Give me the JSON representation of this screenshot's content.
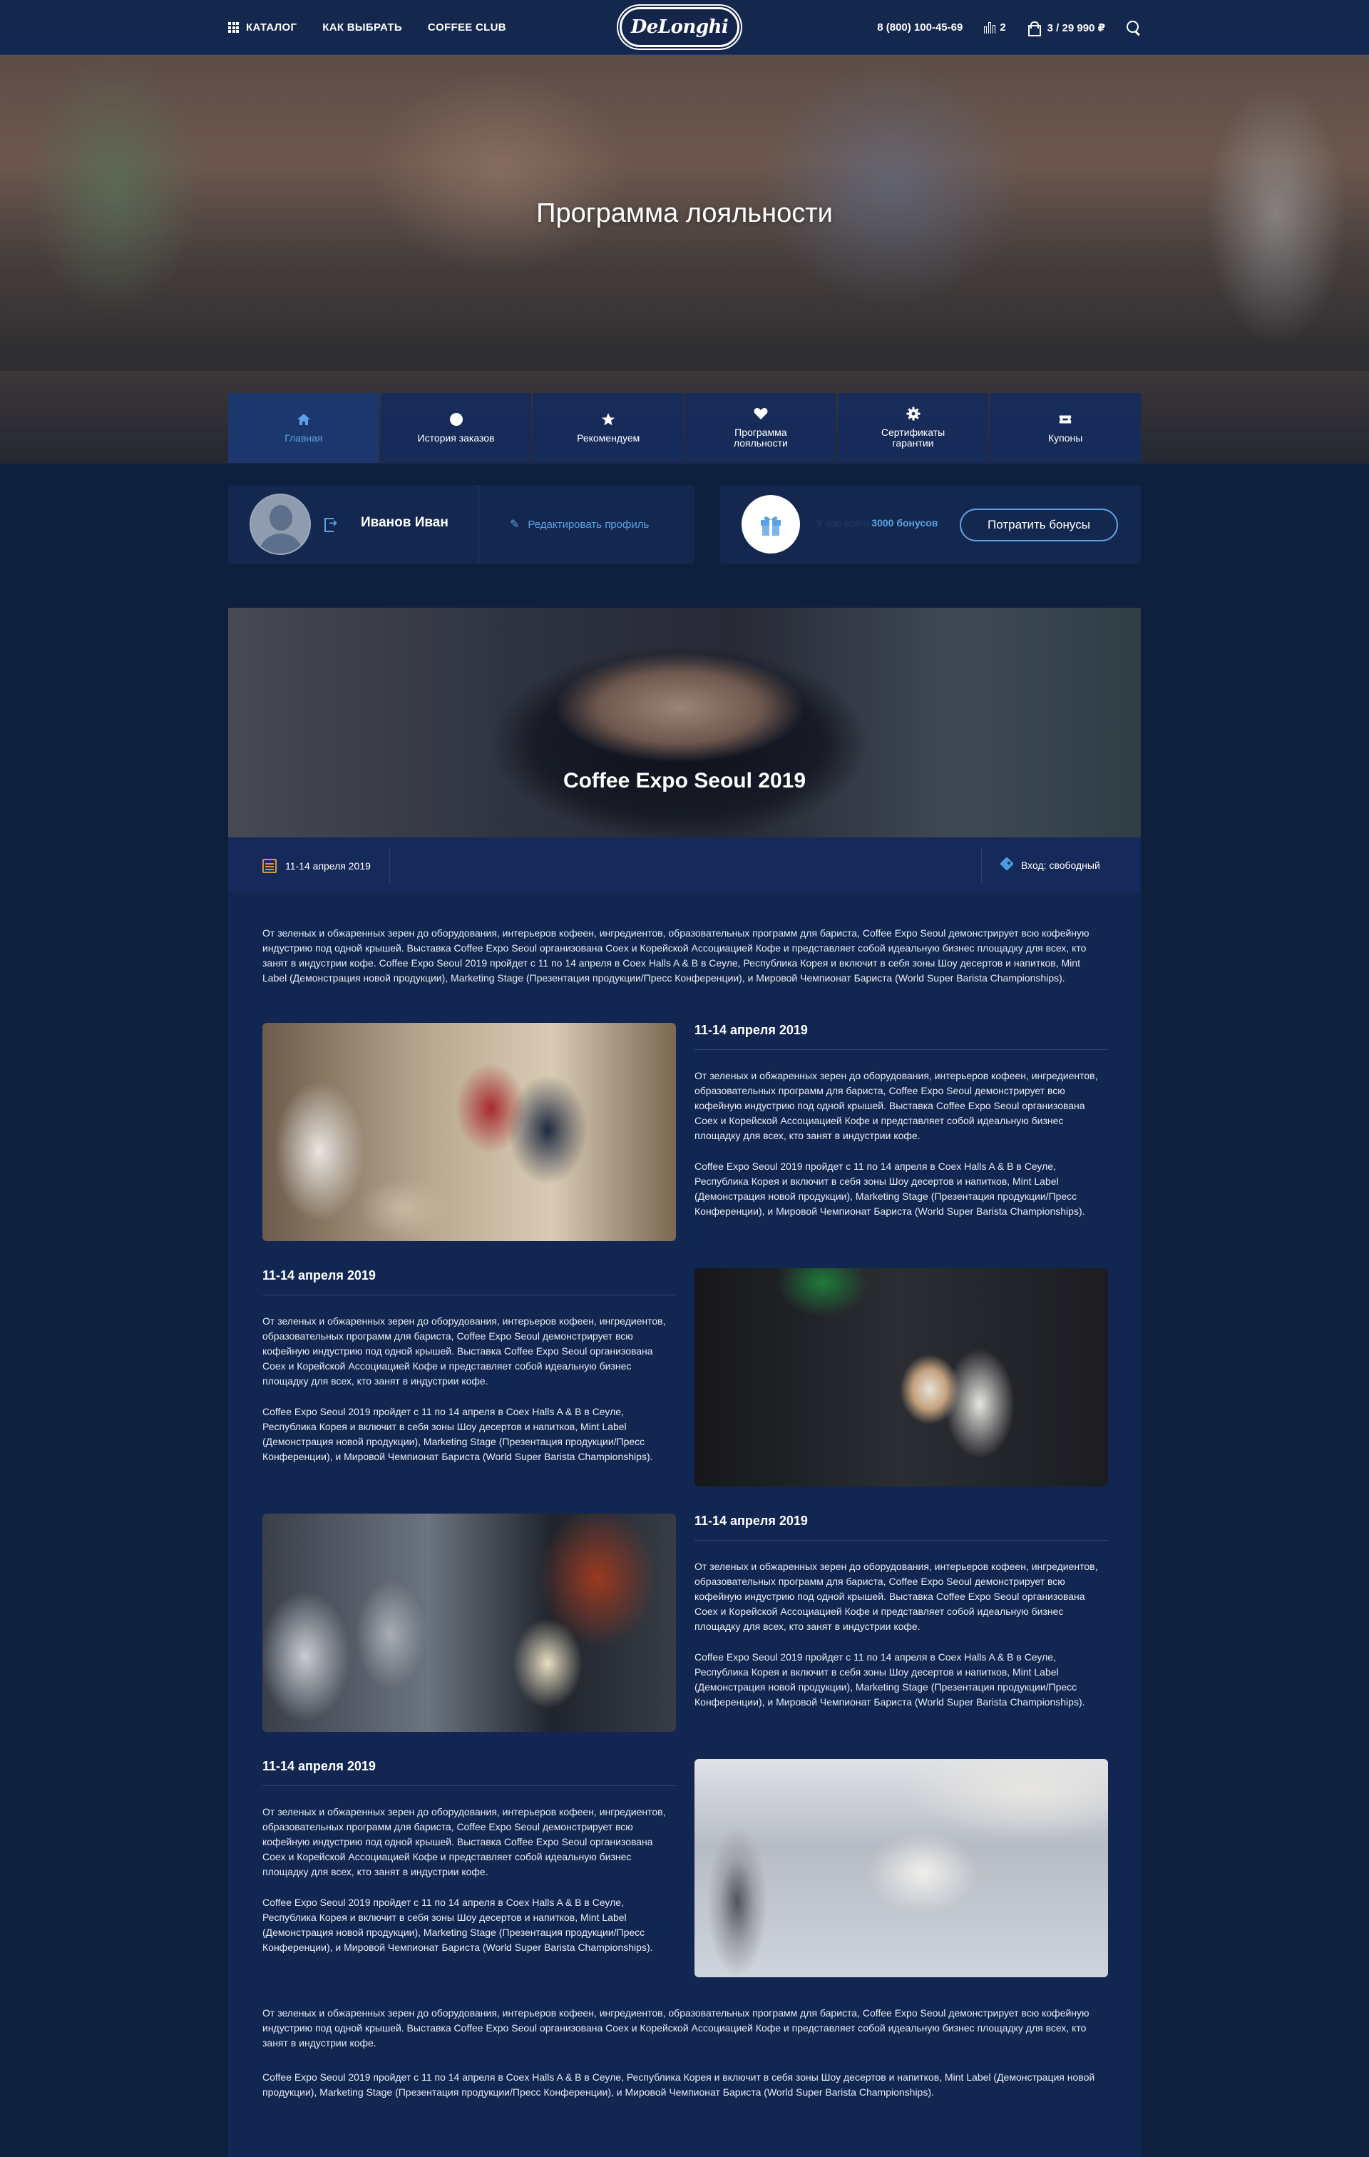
{
  "header": {
    "nav": [
      {
        "label": "КАТАЛОГ",
        "icon": "grid-icon"
      },
      {
        "label": "КАК ВЫБРАТЬ"
      },
      {
        "label": "COFFEE CLUB"
      }
    ],
    "logo_text": "DeLonghi",
    "phone": "8 (800) 100-45-69",
    "compare_count": "2",
    "cart_summary": "3 / 29 990 ₽"
  },
  "hero": {
    "title": "Программа лояльности",
    "tabs": [
      {
        "label": "Главная",
        "icon": "home-icon",
        "active": true
      },
      {
        "label": "История заказов",
        "icon": "circle-icon",
        "active": false
      },
      {
        "label": "Рекомендуем",
        "icon": "star-icon",
        "active": false
      },
      {
        "label": "Программа лояльности",
        "icon": "heart-icon",
        "active": false
      },
      {
        "label": "Сертификаты гарантии",
        "icon": "cog-icon",
        "active": false
      },
      {
        "label": "Купоны",
        "icon": "ticket-icon",
        "active": false
      }
    ]
  },
  "profile": {
    "name": "Иванов Иван",
    "edit_label": "Редактировать профиль"
  },
  "bonus": {
    "prefix": "У вас всего",
    "amount": "3000 бонусов",
    "button_label": "Потратить бонусы"
  },
  "article": {
    "title": "Coffee Expo Seoul 2019",
    "date": "11-14 апреля 2019",
    "entry": "Вход: свободный",
    "intro": "От зеленых и обжаренных зерен до оборудования, интерьеров кофеен, ингредиентов, образовательных программ для бариста, Coffee Expo Seoul демонстрирует всю кофейную индустрию под одной крышей. Выставка Coffee Expo Seoul организована Coex и Корейской Ассоциацией Кофе и представляет собой идеальную бизнес площадку для всех, кто занят в индустрии кофе. Coffee Expo Seoul 2019 пройдет с 11 по 14 апреля в Coex Halls A & B в Сеуле, Республика Корея и включит в себя зоны Шоу десертов и напитков, Mint Label (Демонстрация новой продукции), Marketing Stage (Презентация продукции/Пресс Конференции), и Мировой Чемпионат Бариста (World Super Barista Championships).",
    "sections": [
      {
        "heading": "11-14 апреля 2019",
        "p1": "От зеленых и обжаренных зерен до оборудования, интерьеров кофеен, ингредиентов, образовательных программ для бариста, Coffee Expo Seoul демонстрирует всю кофейную индустрию под одной крышей. Выставка Coffee Expo Seoul организована Coex и Корейской Ассоциацией Кофе и представляет собой идеальную бизнес площадку для всех, кто занят в индустрии кофе.",
        "p2": "Coffee Expo Seoul 2019 пройдет с 11 по 14 апреля в Coex Halls A & B в Сеуле, Республика Корея и включит в себя зоны Шоу десертов и напитков, Mint Label (Демонстрация новой продукции), Marketing Stage (Презентация продукции/Пресс Конференции), и Мировой Чемпионат Бариста (World Super Barista Championships)."
      },
      {
        "heading": "11-14 апреля 2019",
        "p1": "От зеленых и обжаренных зерен до оборудования, интерьеров кофеен, ингредиентов, образовательных программ для бариста, Coffee Expo Seoul демонстрирует всю кофейную индустрию под одной крышей. Выставка Coffee Expo Seoul организована Coex и Корейской Ассоциацией Кофе и представляет собой идеальную бизнес площадку для всех, кто занят в индустрии кофе.",
        "p2": "Coffee Expo Seoul 2019 пройдет с 11 по 14 апреля в Coex Halls A & B в Сеуле, Республика Корея и включит в себя зоны Шоу десертов и напитков, Mint Label (Демонстрация новой продукции), Marketing Stage (Презентация продукции/Пресс Конференции), и Мировой Чемпионат Бариста (World Super Barista Championships)."
      },
      {
        "heading": "11-14 апреля 2019",
        "p1": "От зеленых и обжаренных зерен до оборудования, интерьеров кофеен, ингредиентов, образовательных программ для бариста, Coffee Expo Seoul демонстрирует всю кофейную индустрию под одной крышей. Выставка Coffee Expo Seoul организована Coex и Корейской Ассоциацией Кофе и представляет собой идеальную бизнес площадку для всех, кто занят в индустрии кофе.",
        "p2": "Coffee Expo Seoul 2019 пройдет с 11 по 14 апреля в Coex Halls A & B в Сеуле, Республика Корея и включит в себя зоны Шоу десертов и напитков, Mint Label (Демонстрация новой продукции), Marketing Stage (Презентация продукции/Пресс Конференции), и Мировой Чемпионат Бариста (World Super Barista Championships)."
      },
      {
        "heading": "11-14 апреля 2019",
        "p1": "От зеленых и обжаренных зерен до оборудования, интерьеров кофеен, ингредиентов, образовательных программ для бариста, Coffee Expo Seoul демонстрирует всю кофейную индустрию под одной крышей. Выставка Coffee Expo Seoul организована Coex и Корейской Ассоциацией Кофе и представляет собой идеальную бизнес площадку для всех, кто занят в индустрии кофе.",
        "p2": "Coffee Expo Seoul 2019 пройдет с 11 по 14 апреля в Coex Halls A & B в Сеуле, Республика Корея и включит в себя зоны Шоу десертов и напитков, Mint Label (Демонстрация новой продукции), Marketing Stage (Презентация продукции/Пресс Конференции), и Мировой Чемпионат Бариста (World Super Barista Championships)."
      }
    ],
    "outro1": "От зеленых и обжаренных зерен до оборудования, интерьеров кофеен, ингредиентов, образовательных программ для бариста, Coffee Expo Seoul демонстрирует всю кофейную индустрию под одной крышей. Выставка Coffee Expo Seoul организована Coex и Корейской Ассоциацией Кофе и представляет собой идеальную бизнес площадку для всех, кто занят в индустрии кофе.",
    "outro2": "Coffee Expo Seoul 2019 пройдет с 11 по 14 апреля в Coex Halls A & B в Сеуле, Республика Корея и включит в себя зоны Шоу десертов и напитков, Mint Label (Демонстрация новой продукции), Marketing Stage (Презентация продукции/Пресс Конференции), и Мировой Чемпионат Бариста (World Super Barista Championships)."
  },
  "colors": {
    "page_bg": "#0f1f3e",
    "card_bg": "#14284f",
    "accent": "#5aa2e4",
    "calendar": "#e0953a"
  }
}
